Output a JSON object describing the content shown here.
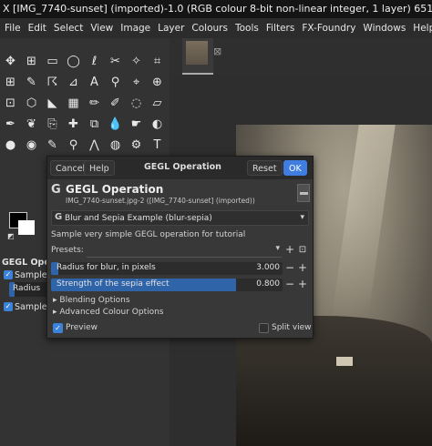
{
  "window": {
    "title": "X [IMG_7740-sunset] (imported)-1.0 (RGB colour 8-bit non-linear integer, 1 layer) 651x977 (5"
  },
  "menubar": {
    "items": [
      "File",
      "Edit",
      "Select",
      "View",
      "Image",
      "Layer",
      "Colours",
      "Tools",
      "Filters",
      "FX-Foundry",
      "Windows",
      "Help"
    ]
  },
  "toolbox": {
    "tool_icons": [
      "move-icon",
      "align-icon",
      "rect-select-icon",
      "ellipse-select-icon",
      "free-select-icon",
      "scissors-select-icon",
      "fuzzy-select-icon",
      "crop-icon",
      "grid-icon",
      "foreground-select-icon",
      "warp-icon",
      "paths-icon",
      "text-icon",
      "color-picker-icon",
      "measure-icon",
      "zoom-icon",
      "perspective-icon",
      "unified-transform-icon",
      "bucket-fill-icon",
      "gradient-icon",
      "paintbrush-icon",
      "pencil-icon",
      "airbrush-icon",
      "eraser-icon",
      "ink-icon",
      "mypaint-icon",
      "clone-icon",
      "heal-icon",
      "perspective-clone-icon",
      "blur-icon",
      "smudge-icon",
      "dodge-icon",
      "drop-icon",
      "picker-icon",
      "eyedropper-icon",
      "magnify-icon",
      "paths-icon",
      "dodge-burn-icon",
      "cage-icon",
      "text-tool-icon"
    ],
    "tool_options": {
      "title": "GEGL Operation",
      "sample_average_label": "Sample a",
      "radius_label": "Radius",
      "sample_merged_label": "Sample m"
    }
  },
  "image_tab": {
    "close_glyph": "⊠"
  },
  "dialog": {
    "cancel_label": "Cancel",
    "help_label": "Help",
    "title": "GEGL Operation",
    "reset_label": "Reset",
    "ok_label": "OK",
    "operation_name": "GEGL Operation",
    "operation_subtitle": "IMG_7740-sunset.jpg-2 ([IMG_7740-sunset] (imported))",
    "operation_select": "Blur and Sepia Example (blur-sepia)",
    "description": "Sample very simple GEGL operation for tutorial",
    "presets_label": "Presets:",
    "params": [
      {
        "label": "Radius for blur, in pixels",
        "value": "3.000",
        "fill": 0.03
      },
      {
        "label": "Strength of the sepia effect",
        "value": "0.800",
        "fill": 0.8
      }
    ],
    "blending_options": "Blending Options",
    "advanced_colour_options": "Advanced Colour Options",
    "preview_label": "Preview",
    "preview_checked": true,
    "split_view_label": "Split view",
    "split_view_checked": false
  },
  "colors": {
    "accent": "#3f7ee0",
    "slider_fill": "#2f64a8",
    "dialog_bg": "#383838"
  }
}
